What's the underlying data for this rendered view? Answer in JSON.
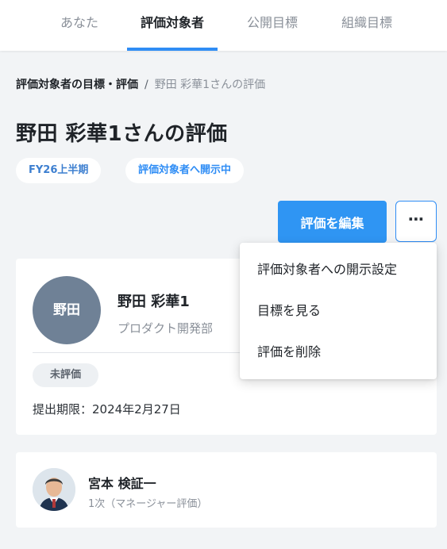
{
  "tabs": [
    {
      "label": "あなた"
    },
    {
      "label": "評価対象者"
    },
    {
      "label": "公開目標"
    },
    {
      "label": "組織目標"
    }
  ],
  "breadcrumb": {
    "parent": "評価対象者の目標・評価",
    "separator": "/",
    "current": "野田 彩華1さんの評価"
  },
  "page_title": "野田 彩華1さんの評価",
  "chips": {
    "period": "FY26上半期",
    "status": "評価対象者へ開示中"
  },
  "actions": {
    "edit_label": "評価を編集",
    "more_label": "⋯"
  },
  "menu": {
    "items": [
      "評価対象者への開示設定",
      "目標を見る",
      "評価を削除"
    ]
  },
  "employee": {
    "avatar_text": "野田",
    "name": "野田 彩華1",
    "department": "プロダクト開発部",
    "evaluation_status": "未評価",
    "deadline": "提出期限：2024年2月27日"
  },
  "reviewer": {
    "name": "宮本 検証一",
    "role": "1次（マネージャー評価）"
  },
  "colors": {
    "accent": "#2f8df5",
    "primary_button": "#2f95f3",
    "avatar_bg": "#6f8196",
    "page_bg": "#f2f4f6"
  }
}
